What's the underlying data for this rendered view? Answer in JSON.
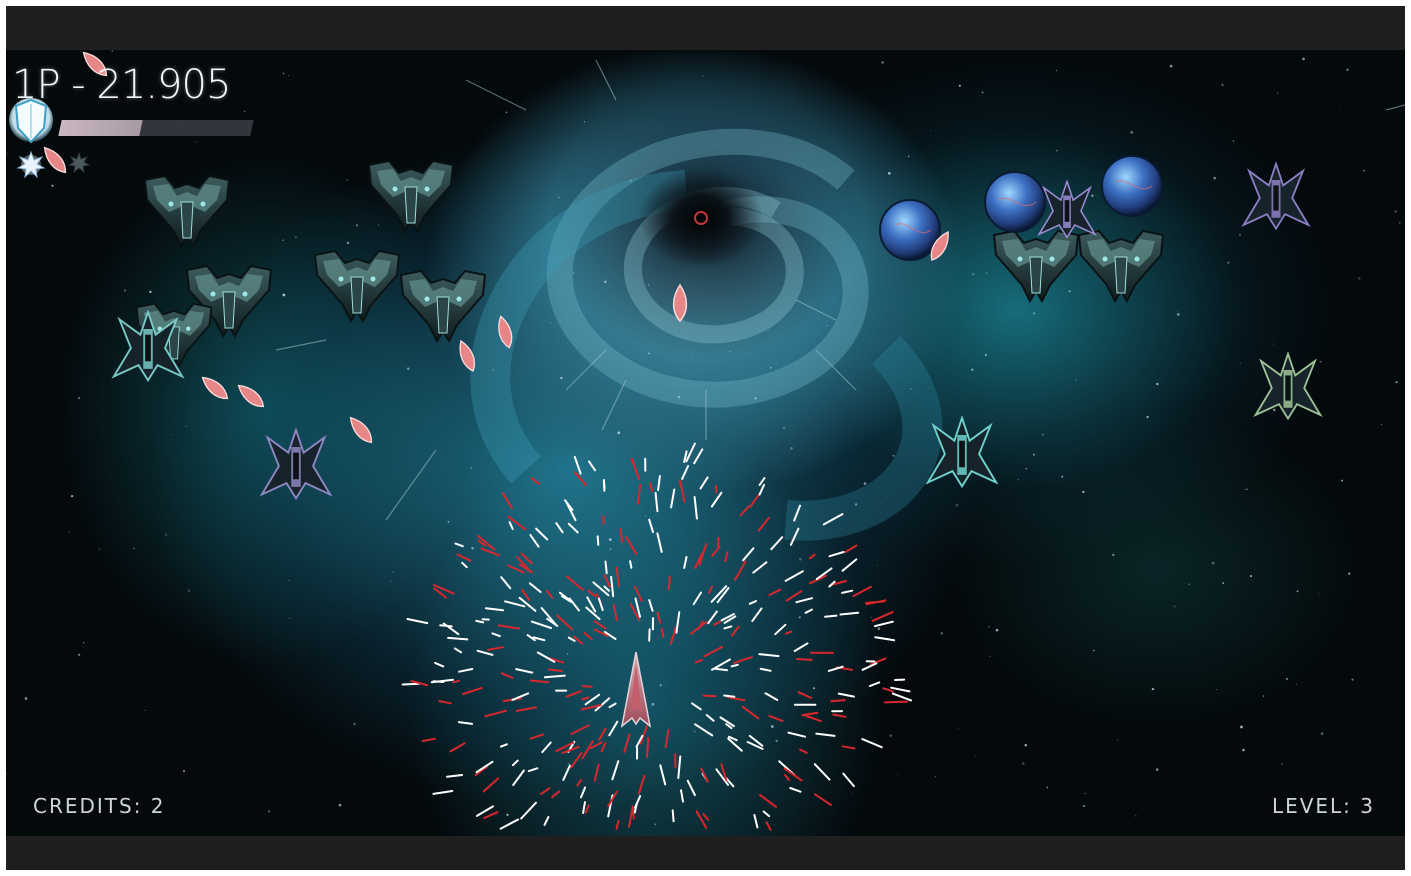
{
  "hud": {
    "score_text": "1P - 21.905",
    "credits_text": "CREDITS: 2",
    "level_text": "LEVEL: 3",
    "health_fraction": 0.42
  },
  "colors": {
    "nebula": "#2c6f86",
    "enemy_hull": "#1e2e33",
    "enemy_glow": "#7fd3d2",
    "enemy_bullet": "#e88c8c",
    "player_shot_red": "#d9272e",
    "player_shot_white": "#ffffff"
  },
  "icons": {
    "shield": "shield-icon",
    "bomb": "bomb-icon",
    "player": "player-ship-icon"
  }
}
